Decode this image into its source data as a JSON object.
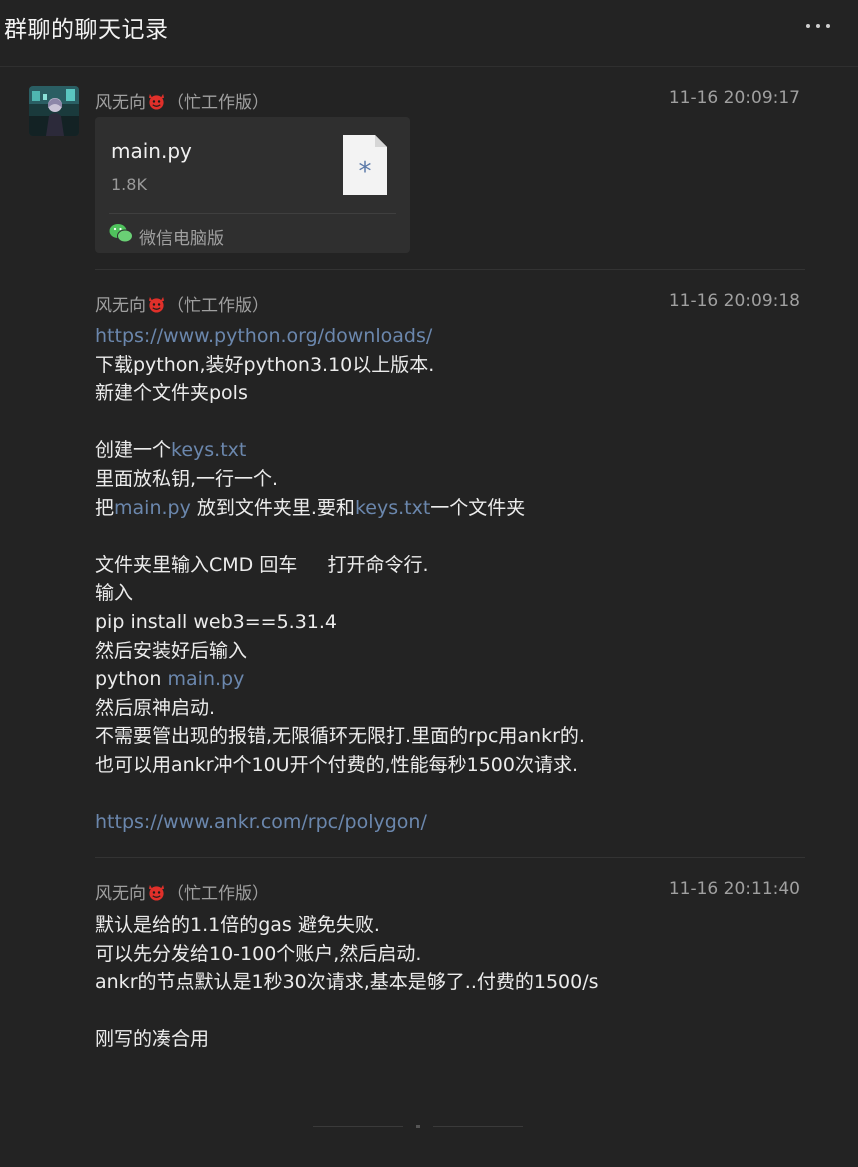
{
  "window": {
    "title": "群聊的聊天记录",
    "more_icon": "more-horizontal-icon"
  },
  "messages": [
    {
      "sender": {
        "name": "风无向",
        "emoji": "devil-face-icon",
        "suffix": "（忙工作版）"
      },
      "time": "11-16 20:09:17",
      "file": {
        "name": "main.py",
        "size": "1.8K",
        "icon": "generic-file-icon",
        "source": "微信电脑版",
        "source_icon": "wechat-icon"
      }
    },
    {
      "sender": {
        "name": "风无向",
        "emoji": "devil-face-icon",
        "suffix": "（忙工作版）"
      },
      "time": "11-16 20:09:18",
      "lines": [
        {
          "t1": "",
          "link1": "https://www.python.org/downloads/",
          "t2": "",
          "link2": "",
          "t3": ""
        },
        {
          "t1": "下载python,装好python3.10以上版本.",
          "link1": "",
          "t2": "",
          "link2": "",
          "t3": ""
        },
        {
          "t1": "新建个文件夹pols",
          "link1": "",
          "t2": "",
          "link2": "",
          "t3": ""
        },
        {
          "t1": "",
          "link1": "",
          "t2": "",
          "link2": "",
          "t3": ""
        },
        {
          "t1": "创建一个",
          "link1": "keys.txt",
          "t2": "",
          "link2": "",
          "t3": ""
        },
        {
          "t1": "里面放私钥,一行一个.",
          "link1": "",
          "t2": "",
          "link2": "",
          "t3": ""
        },
        {
          "t1": "把",
          "link1": "main.py",
          "t2": " 放到文件夹里.要和",
          "link2": "keys.txt",
          "t3": "一个文件夹"
        },
        {
          "t1": "",
          "link1": "",
          "t2": "",
          "link2": "",
          "t3": ""
        },
        {
          "t1": "文件夹里输入CMD 回车     打开命令行.",
          "link1": "",
          "t2": "",
          "link2": "",
          "t3": ""
        },
        {
          "t1": "输入",
          "link1": "",
          "t2": "",
          "link2": "",
          "t3": ""
        },
        {
          "t1": "pip install web3==5.31.4",
          "link1": "",
          "t2": "",
          "link2": "",
          "t3": ""
        },
        {
          "t1": "然后安装好后输入",
          "link1": "",
          "t2": "",
          "link2": "",
          "t3": ""
        },
        {
          "t1": "python ",
          "link1": "main.py",
          "t2": "",
          "link2": "",
          "t3": ""
        },
        {
          "t1": "然后原神启动.",
          "link1": "",
          "t2": "",
          "link2": "",
          "t3": ""
        },
        {
          "t1": "不需要管出现的报错,无限循环无限打.里面的rpc用ankr的.",
          "link1": "",
          "t2": "",
          "link2": "",
          "t3": ""
        },
        {
          "t1": "也可以用ankr冲个10U开个付费的,性能每秒1500次请求.",
          "link1": "",
          "t2": "",
          "link2": "",
          "t3": ""
        },
        {
          "t1": "",
          "link1": "",
          "t2": "",
          "link2": "",
          "t3": ""
        },
        {
          "t1": "",
          "link1": "https://www.ankr.com/rpc/polygon/",
          "t2": "",
          "link2": "",
          "t3": ""
        }
      ]
    },
    {
      "sender": {
        "name": "风无向",
        "emoji": "devil-face-icon",
        "suffix": "（忙工作版）"
      },
      "time": "11-16 20:11:40",
      "lines": [
        {
          "t1": "默认是给的1.1倍的gas 避免失败.",
          "link1": "",
          "t2": "",
          "link2": "",
          "t3": ""
        },
        {
          "t1": "可以先分发给10-100个账户,然后启动.",
          "link1": "",
          "t2": "",
          "link2": "",
          "t3": ""
        },
        {
          "t1": "ankr的节点默认是1秒30次请求,基本是够了..付费的1500/s",
          "link1": "",
          "t2": "",
          "link2": "",
          "t3": ""
        },
        {
          "t1": "",
          "link1": "",
          "t2": "",
          "link2": "",
          "t3": ""
        },
        {
          "t1": "刚写的凑合用",
          "link1": "",
          "t2": "",
          "link2": "",
          "t3": ""
        }
      ]
    }
  ],
  "colors": {
    "background": "#232323",
    "link": "#6b87ad",
    "devil": "#e0302a",
    "wechat": "#4fc25c"
  }
}
